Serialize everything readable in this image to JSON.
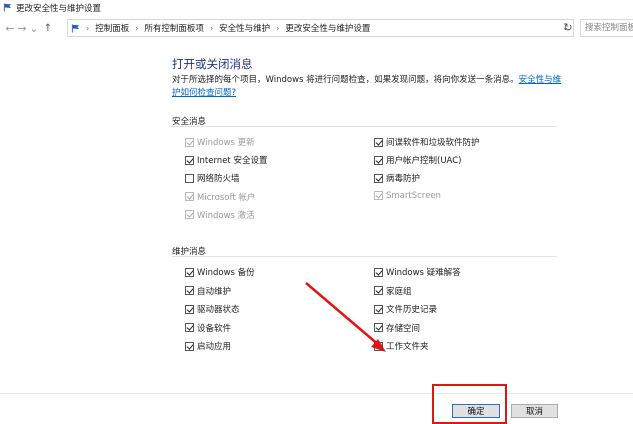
{
  "window": {
    "title": "更改安全性与维护设置"
  },
  "navigation": {
    "back_icon": "←",
    "forward_icon": "→",
    "history_icon": "⌄",
    "up_icon": "↑",
    "breadcrumbs": [
      "控制面板",
      "所有控制面板项",
      "安全性与维护",
      "更改安全性与维护设置"
    ],
    "refresh_icon": "↻",
    "search_placeholder": "搜索控制面板"
  },
  "main": {
    "heading": "打开或关闭消息",
    "description_text": "对于所选择的每个项目，Windows 将进行问题检查，如果发现问题，将向你发送一条消息。",
    "description_link": "安全性与维护如何检查问题?"
  },
  "security_messages": {
    "title": "安全消息",
    "left": [
      {
        "label": "Windows 更新",
        "checked": true,
        "disabled": true
      },
      {
        "label": "Internet 安全设置",
        "checked": true,
        "disabled": false
      },
      {
        "label": "网络防火墙",
        "checked": false,
        "disabled": false
      },
      {
        "label": "Microsoft 帐户",
        "checked": true,
        "disabled": true
      },
      {
        "label": "Windows 激活",
        "checked": true,
        "disabled": true
      }
    ],
    "right": [
      {
        "label": "间谍软件和垃圾软件防护",
        "checked": true,
        "disabled": false
      },
      {
        "label": "用户帐户控制(UAC)",
        "checked": true,
        "disabled": false
      },
      {
        "label": "病毒防护",
        "checked": true,
        "disabled": false
      },
      {
        "label": "SmartScreen",
        "checked": true,
        "disabled": true
      }
    ]
  },
  "maintenance_messages": {
    "title": "维护消息",
    "left": [
      {
        "label": "Windows 备份",
        "checked": true,
        "disabled": false
      },
      {
        "label": "自动维护",
        "checked": true,
        "disabled": false
      },
      {
        "label": "驱动器状态",
        "checked": true,
        "disabled": false
      },
      {
        "label": "设备软件",
        "checked": true,
        "disabled": false
      },
      {
        "label": "启动应用",
        "checked": true,
        "disabled": false
      }
    ],
    "right": [
      {
        "label": "Windows 疑难解答",
        "checked": true,
        "disabled": false
      },
      {
        "label": "家庭组",
        "checked": true,
        "disabled": false
      },
      {
        "label": "文件历史记录",
        "checked": true,
        "disabled": false
      },
      {
        "label": "存储空间",
        "checked": true,
        "disabled": false
      },
      {
        "label": "工作文件夹",
        "checked": true,
        "disabled": false
      }
    ]
  },
  "footer": {
    "ok_label": "确定",
    "cancel_label": "取消"
  },
  "colors": {
    "heading": "#1e3287",
    "link": "#0066cc",
    "annotation": "#e01616"
  }
}
